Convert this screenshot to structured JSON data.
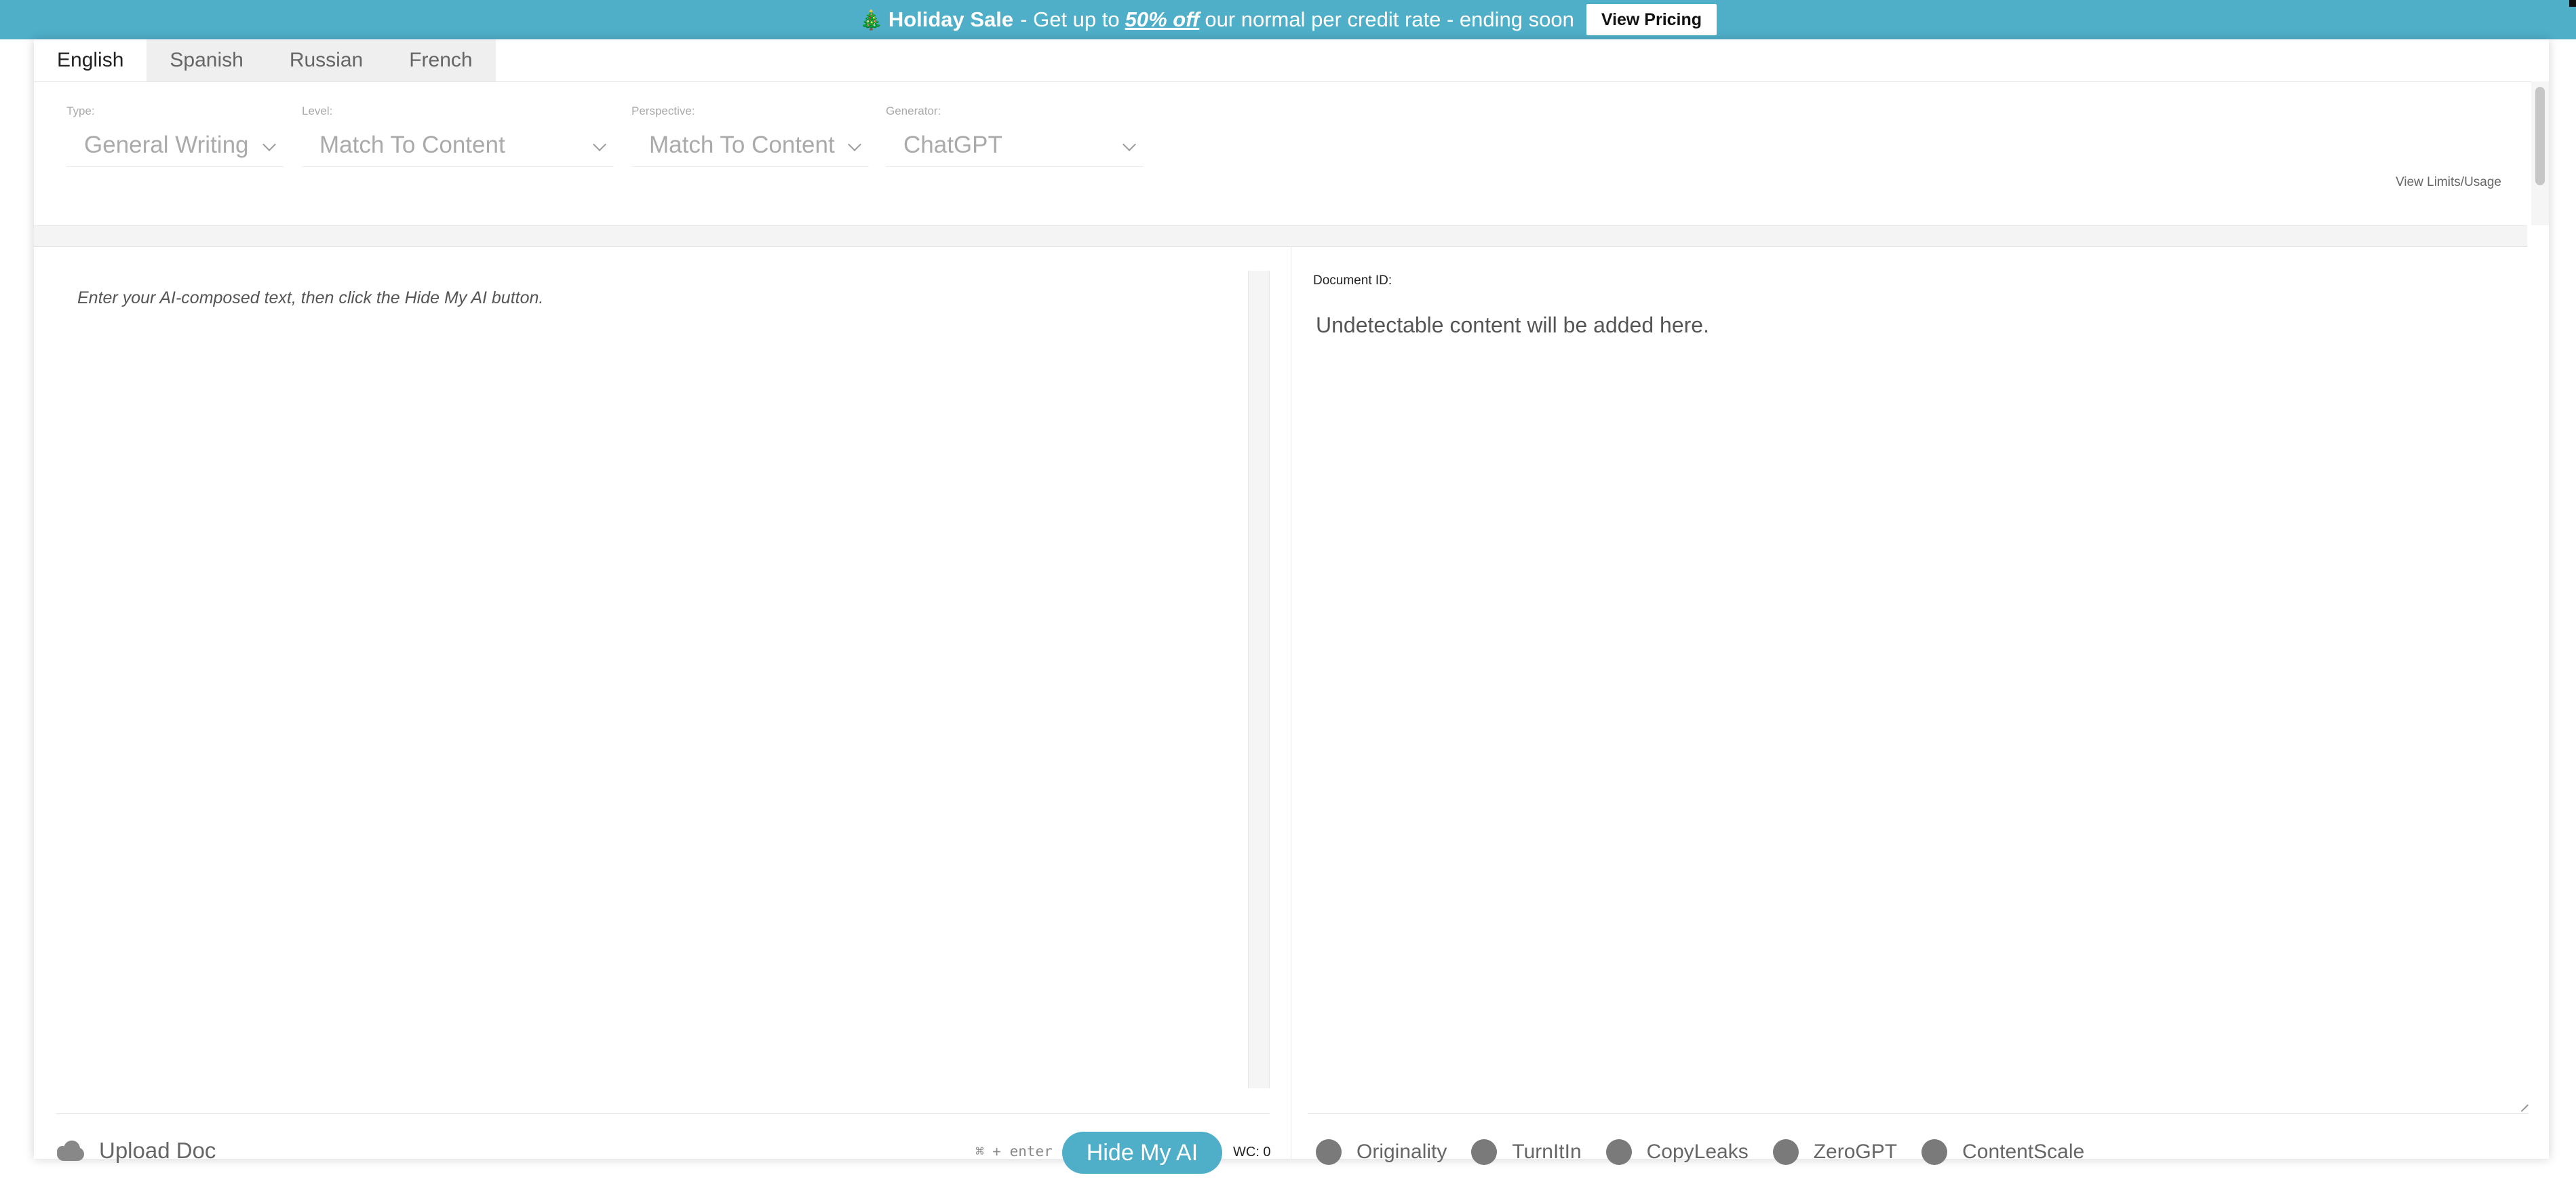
{
  "banner": {
    "tree_icon": "🎄",
    "sale_title": "Holiday Sale",
    "text_before": "- Get up to",
    "discount": "50% off",
    "text_after": "our normal per credit rate - ending soon",
    "button_label": "View Pricing",
    "color": "#4fafc9"
  },
  "tabs": [
    {
      "label": "English",
      "active": true
    },
    {
      "label": "Spanish",
      "active": false
    },
    {
      "label": "Russian",
      "active": false
    },
    {
      "label": "French",
      "active": false
    }
  ],
  "settings": {
    "type": {
      "label": "Type:",
      "value": "General Writing"
    },
    "level": {
      "label": "Level:",
      "value": "Match To Content"
    },
    "perspective": {
      "label": "Perspective:",
      "value": "Match To Content"
    },
    "generator": {
      "label": "Generator:",
      "value": "ChatGPT"
    },
    "view_limits": "View Limits/Usage"
  },
  "editor": {
    "placeholder": "Enter your AI-composed text, then click the Hide My AI button.",
    "upload_label": "Upload Doc",
    "shortcut_hint": "⌘ + enter",
    "hide_button": "Hide My AI",
    "word_count": "WC: 0"
  },
  "output": {
    "document_id_label": "Document ID:",
    "placeholder": "Undetectable content will be added here."
  },
  "detectors": [
    {
      "label": "Originality"
    },
    {
      "label": "TurnItIn"
    },
    {
      "label": "CopyLeaks"
    },
    {
      "label": "ZeroGPT"
    },
    {
      "label": "ContentScale"
    }
  ],
  "accent_color": "#4fafc9"
}
